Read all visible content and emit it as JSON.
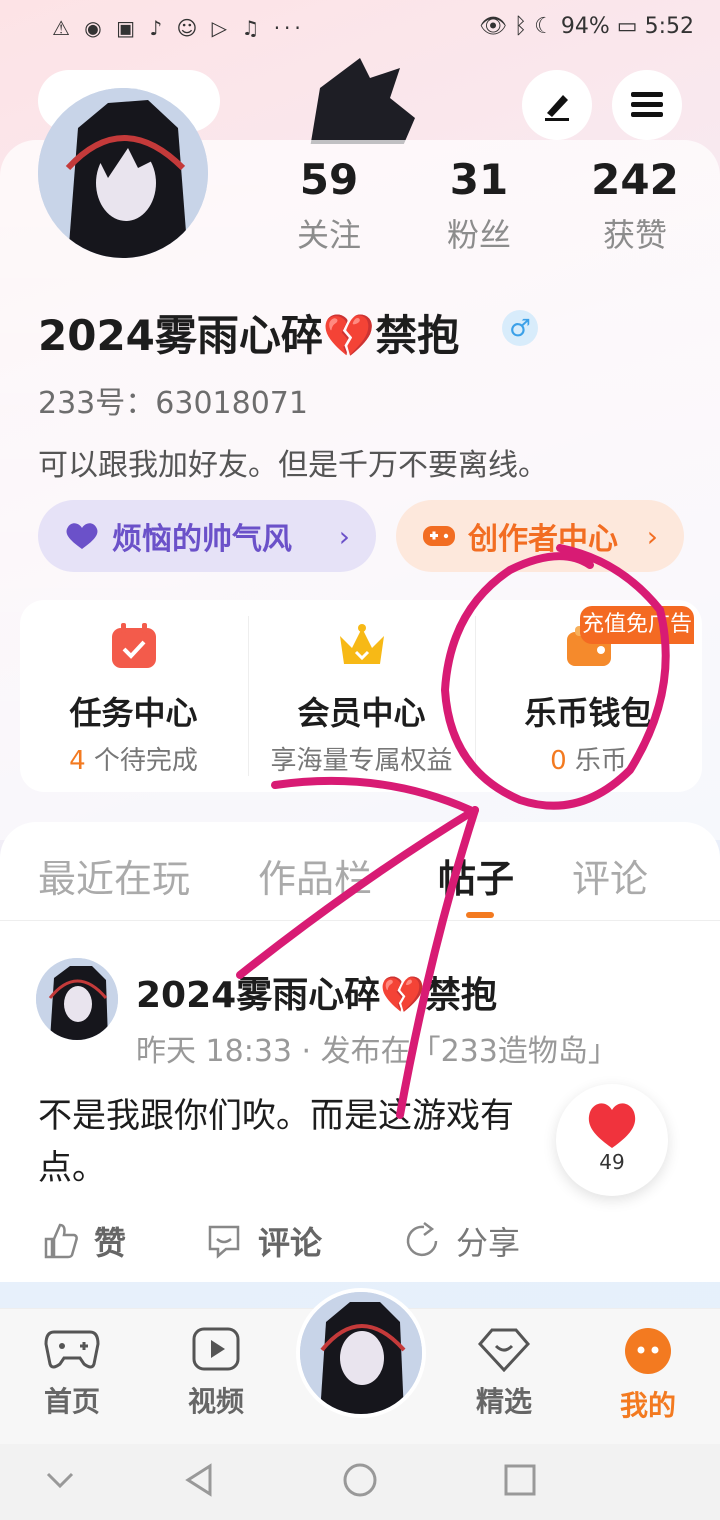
{
  "status_bar": {
    "left_icons": [
      "alert-icon",
      "wifi-icon",
      "shield-app-icon",
      "tiktok-icon",
      "game-app-icon",
      "video-app-icon",
      "music-app-icon",
      "more-icon"
    ],
    "battery": "94%",
    "time": "5:52"
  },
  "profile": {
    "name": "2024雾雨心碎💔禁抱",
    "gender_symbol": "♂",
    "uid_label": "233号：",
    "uid": "63018071",
    "bio": "可以跟我加好友。但是千万不要离线。",
    "stats": [
      {
        "value": "59",
        "label": "关注"
      },
      {
        "value": "31",
        "label": "粉丝"
      },
      {
        "value": "242",
        "label": "获赞"
      }
    ],
    "chips": [
      {
        "label": "烦恼的帅气风",
        "chevron": "›"
      },
      {
        "label": "创作者中心",
        "chevron": "›"
      }
    ]
  },
  "features": [
    {
      "title": "任务中心",
      "sub_count": "4",
      "sub_text": " 个待完成"
    },
    {
      "title": "会员中心",
      "sub_text": "享海量专属权益"
    },
    {
      "title": "乐币钱包",
      "sub_count": "0",
      "sub_text": " 乐币"
    }
  ],
  "promo_badge": "充值免广告",
  "tabs": [
    "最近在玩",
    "作品栏",
    "帖子",
    "评论"
  ],
  "active_tab": 2,
  "post": {
    "author": "2024雾雨心碎💔禁抱",
    "meta": "昨天 18:33 · 发布在「233造物岛」",
    "text": "不是我跟你们吹。而是这游戏有点。",
    "like_count": "49",
    "actions": [
      "赞",
      "评论",
      "分享"
    ]
  },
  "bottom_nav": [
    "首页",
    "视频",
    "精选",
    "我的"
  ],
  "colors": {
    "accent": "#f37a20",
    "annotation": "#d81b74",
    "purple": "#6b51c9"
  }
}
